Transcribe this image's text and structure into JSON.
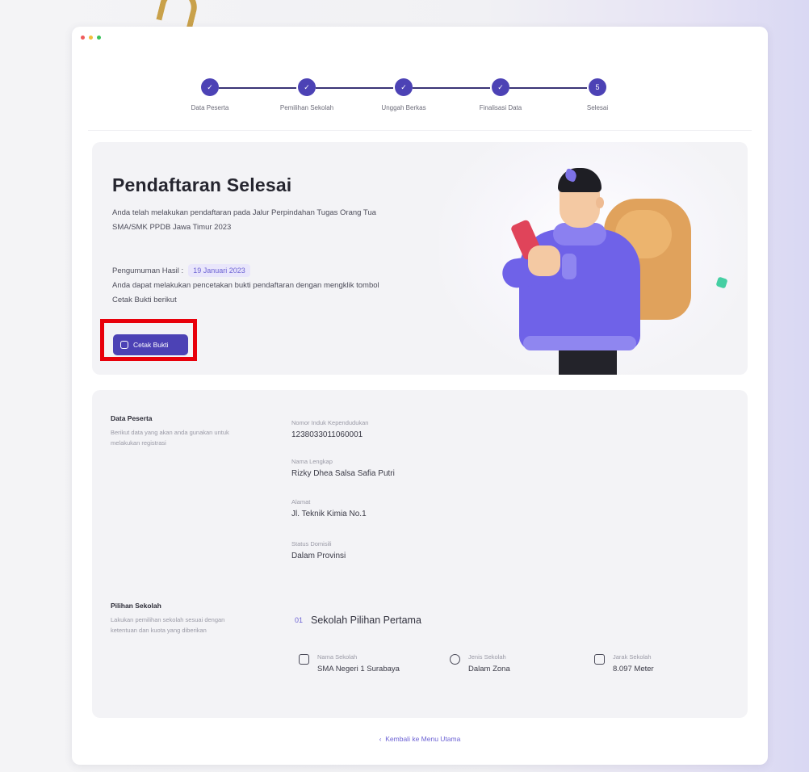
{
  "stepper": {
    "steps": [
      {
        "label": "Data Peserta",
        "mark": "✓"
      },
      {
        "label": "Pemilihan Sekolah",
        "mark": "✓"
      },
      {
        "label": "Unggah Berkas",
        "mark": "✓"
      },
      {
        "label": "Finalisasi Data",
        "mark": "✓"
      },
      {
        "label": "Selesai",
        "mark": "5"
      }
    ]
  },
  "hero": {
    "title": "Pendaftaran Selesai",
    "description": "Anda telah melakukan pendaftaran pada Jalur Perpindahan Tugas Orang Tua SMA/SMK PPDB Jawa Timur 2023",
    "announce_label": "Pengumuman Hasil :",
    "announce_date": "19 Januari 2023",
    "print_instruction": "Anda dapat melakukan pencetakan bukti pendaftaran dengan mengklik tombol Cetak Bukti berikut",
    "print_button": "Cetak Bukti"
  },
  "participant": {
    "title": "Data Peserta",
    "description": "Berikut data yang akan anda gunakan untuk melakukan registrasi",
    "fields": [
      {
        "label": "Nomor Induk Kependudukan",
        "value": "1238033011060001"
      },
      {
        "label": "Nama Lengkap",
        "value": "Rizky Dhea Salsa Safia Putri"
      },
      {
        "label": "Alamat",
        "value": "Jl. Teknik Kimia No.1"
      },
      {
        "label": "Status Domisili",
        "value": "Dalam Provinsi"
      }
    ]
  },
  "school": {
    "title": "Pilihan Sekolah",
    "description": "Lakukan pemilihan sekolah sesuai dengan ketentuan dan kuota yang diberikan",
    "choice_number": "01",
    "choice_title": "Sekolah Pilihan Pertama",
    "meta": [
      {
        "icon": "graduation-cap-icon",
        "label": "Nama Sekolah",
        "value": "SMA Negeri 1 Surabaya"
      },
      {
        "icon": "globe-icon",
        "label": "Jenis Sekolah",
        "value": "Dalam Zona"
      },
      {
        "icon": "map-icon",
        "label": "Jarak Sekolah",
        "value": "8.097 Meter"
      }
    ]
  },
  "footer": {
    "back_arrow": "‹",
    "back_label": "Kembali ke Menu Utama"
  },
  "colors": {
    "primary": "#4c42b5",
    "highlight": "#e8000b"
  }
}
